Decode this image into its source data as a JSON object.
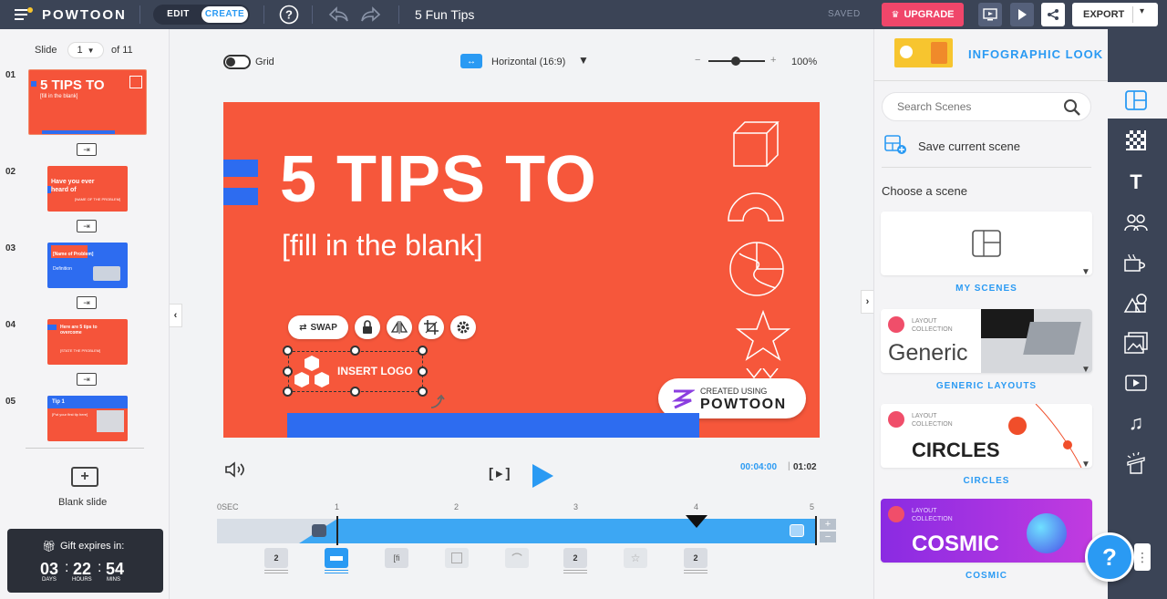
{
  "topbar": {
    "brand": "POWTOON",
    "edit_label": "EDIT",
    "create_label": "CREATE",
    "title": "5 Fun Tips",
    "saved_label": "SAVED",
    "upgrade_label": "UPGRADE",
    "export_label": "EXPORT"
  },
  "slides": {
    "label": "Slide",
    "current": "1",
    "of_label": "of 11",
    "blank_label": "Blank slide",
    "items": [
      {
        "num": "01",
        "title": "5 TIPS TO",
        "sub": "[fill in the blank]"
      },
      {
        "num": "02",
        "title": "Have you ever heard of",
        "sub": "[NAME OF THE PROBLEM]"
      },
      {
        "num": "03",
        "title": "[Name of Problem]",
        "sub": "Definition"
      },
      {
        "num": "04",
        "title": "Here are 5 tips to overcome",
        "sub": "[STATE THE PROBLEM]"
      },
      {
        "num": "05",
        "title": "Tip 1",
        "sub": "[Put your first tip here]"
      }
    ]
  },
  "gift": {
    "label": "Gift expires in:",
    "days": "03",
    "hours": "22",
    "mins": "54",
    "days_label": "DAYS",
    "hours_label": "HOURS",
    "mins_label": "MINS"
  },
  "canvas": {
    "grid_label": "Grid",
    "orientation": "Horizontal (16:9)",
    "zoom": "100%",
    "title": "5 TIPS TO",
    "subtitle": "[fill in the blank]",
    "swap_label": "SWAP",
    "insert_logo": "INSERT LOGO",
    "badge_small": "CREATED USING",
    "badge_brand": "POWTOON"
  },
  "timeline": {
    "current_time": "00:04:00",
    "total_time": "01:02",
    "ticks": [
      "0SEC",
      "1",
      "2",
      "3",
      "4",
      "5"
    ],
    "chips": [
      {
        "label": "2"
      },
      {
        "label": ""
      },
      {
        "label": "[fi"
      },
      {
        "label": ""
      },
      {
        "label": ""
      },
      {
        "label": "2"
      },
      {
        "label": ""
      },
      {
        "label": "2"
      }
    ]
  },
  "scenes": {
    "look_label": "INFOGRAPHIC LOOK",
    "search_placeholder": "Search Scenes",
    "save_label": "Save current scene",
    "choose_label": "Choose a scene",
    "collection_small": "LAYOUT COLLECTION",
    "items": [
      {
        "title": "MY SCENES",
        "card_text": ""
      },
      {
        "title": "GENERIC LAYOUTS",
        "card_text": "Generic"
      },
      {
        "title": "CIRCLES",
        "card_text": "CIRCLES"
      },
      {
        "title": "COSMIC",
        "card_text": "COSMIC"
      }
    ]
  },
  "help": {
    "label": "?"
  },
  "colors": {
    "accent": "#2a9af3",
    "brand_orange": "#f6573b",
    "topbar": "#3b4456",
    "upgrade": "#f0466a"
  }
}
